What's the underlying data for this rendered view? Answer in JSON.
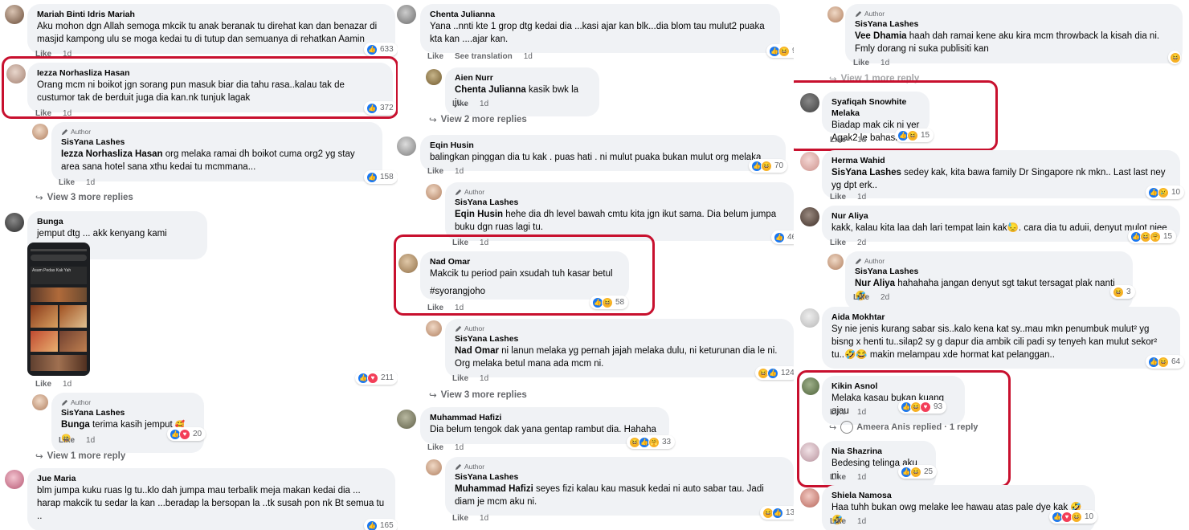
{
  "labels": {
    "like": "Like",
    "author": "Author",
    "see_translation": "See translation"
  },
  "col1": {
    "c1": {
      "name": "Mariah Binti Idris Mariah",
      "text": "Aku mohon dgn Allah semoga mkcik tu anak beranak tu direhat kan dan benazar di masjid kampong ulu se moga kedai tu di tutup dan semuanya di rehatkan Aamin",
      "time": "1d",
      "count": "633"
    },
    "c2": {
      "name": "Iezza Norhasliza Hasan",
      "text": "Orang mcm ni boikot jgn sorang pun masuk biar dia tahu rasa..kalau tak de custumor tak de berduit juga dia kan.nk tunjuk lagak",
      "time": "1d",
      "count": "372"
    },
    "r2": {
      "name": "SisYana Lashes",
      "mention": "Iezza Norhasliza Hasan",
      "text": " org melaka ramai dh boikot cuma org2 yg stay area sana hotel sana xthu kedai tu mcmmana...",
      "time": "1d",
      "count": "158"
    },
    "v2": "View 3 more replies",
    "c3": {
      "name": "Bunga",
      "text": "jemput dtg ... akk kenyang kami senang",
      "time": "1d",
      "count": "211"
    },
    "r3": {
      "name": "SisYana Lashes",
      "mention": "Bunga",
      "text": " terima kasih jemput",
      "time": "1d",
      "count": "20"
    },
    "v3": "View 1 more reply",
    "c4": {
      "name": "Jue Maria",
      "text": "blm jumpa kuku ruas lg tu..klo dah jumpa mau terbalik meja makan kedai dia ... harap makcik tu sedar la kan ...beradap la bersopan la ..tk susah pon nk Bt semua tu ..",
      "count": "165"
    }
  },
  "col2": {
    "c1": {
      "name": "Chenta Julianna",
      "text": "Yana ..nnti kte 1 grop dtg kedai dia ...kasi ajar kan blk...dia blom tau mulut2 puaka kta kan ....ajar kan.",
      "time": "1d",
      "count": "9"
    },
    "r1": {
      "name": "Aien Nurr",
      "mention": "Chenta Julianna",
      "text": " kasik bwk la ju..",
      "time": "1d"
    },
    "v1": "View 2 more replies",
    "c2": {
      "name": "Eqin Husin",
      "text": "balingkan pinggan dia tu kak . puas hati . ni mulut puaka bukan mulut org melaka",
      "time": "1d",
      "count": "70"
    },
    "r2": {
      "name": "SisYana Lashes",
      "mention": "Eqin Husin",
      "text": " hehe dia dh level bawah cmtu kita jgn ikut sama. Dia belum jumpa buku dgn ruas lagi tu.",
      "time": "1d",
      "count": "46"
    },
    "c3": {
      "name": "Nad Omar",
      "text": "Makcik tu period pain xsudah tuh kasar betul",
      "text2": "#syorangjoho",
      "time": "1d",
      "count": "58"
    },
    "r3": {
      "name": "SisYana Lashes",
      "mention": "Nad Omar",
      "text": " ni lanun melaka yg pernah jajah melaka dulu, ni keturunan dia le ni. Org melaka betul mana ada mcm ni.",
      "time": "1d",
      "count": "124"
    },
    "v3": "View 3 more replies",
    "c4": {
      "name": "Muhammad Hafizi",
      "text": "Dia belum tengok dak yana gentap rambut dia. Hahaha",
      "time": "1d",
      "count": "33"
    },
    "r4": {
      "name": "SisYana Lashes",
      "mention": "Muhammad Hafizi",
      "text": " seyes fizi kalau kau masuk kedai ni auto sabar tau. Jadi diam je mcm aku ni.",
      "time": "1d",
      "count": "13"
    }
  },
  "col3": {
    "r0": {
      "name": "SisYana Lashes",
      "mention": "Vee Dhamia",
      "text": " haah dah ramai kene aku kira mcm throwback la kisah dia ni. Fmly dorang ni suka publisiti kan",
      "time": "1d"
    },
    "v0": "View 1 more reply",
    "c1": {
      "name": "Syafiqah Snowhite Melaka",
      "text": "Biadap mak cik ni yer",
      "text2": "Agak2 le bahasa tu",
      "time": "1d",
      "count": "15"
    },
    "c2": {
      "name": "Herma Wahid",
      "mention": "SisYana Lashes",
      "text": " sedey kak, kita bawa family Dr Singapore nk mkn.. Last last ney yg dpt erk..",
      "time": "1d",
      "count": "10"
    },
    "c3": {
      "name": "Nur Aliya",
      "text": "kakk, kalau kita laa dah lari tempat lain kak😓. cara dia tu aduii, denyut mulot niee",
      "time": "2d",
      "count": "15"
    },
    "r3": {
      "name": "SisYana Lashes",
      "mention": "Nur Aliya",
      "text": " hahahaha jangan denyut sgt takut tersagat plak nanti 🤣",
      "time": "2d",
      "count": "3"
    },
    "c4": {
      "name": "Aida Mokhtar",
      "text": "Sy nie jenis kurang sabar sis..kalo kena kat sy..mau mkn penumbuk mulut² yg bisng x henti tu..silap2 sy g dapur dia ambik cili padi sy tenyeh kan mulut sekor² tu..🤣😂 makin melampau xde hormat kat pelanggan..",
      "time": "1d",
      "count": "64"
    },
    "c5": {
      "name": "Kikin Asnol",
      "text": "Melaka kasau bukan kuang ajau",
      "time": "1d",
      "count": "93"
    },
    "rp5": "Ameera Anis replied · 1 reply",
    "c6": {
      "name": "Nia Shazrina",
      "text": "Bedesing telinga aku ni..",
      "time": "1d",
      "count": "25"
    },
    "c7": {
      "name": "Shiela Namosa",
      "text": "Haa tuhh bukan owg melake lee hawau atas pale dye kak 🤣🤣",
      "time": "1d",
      "count": "10"
    }
  },
  "image_post": {
    "caption": "Asam Pedas Kak Yah"
  },
  "colors": {
    "highlight": "#c8102e",
    "bubble": "#f0f2f5",
    "like": "#1877f2",
    "love": "#f33e58",
    "haha": "#f7b125"
  }
}
